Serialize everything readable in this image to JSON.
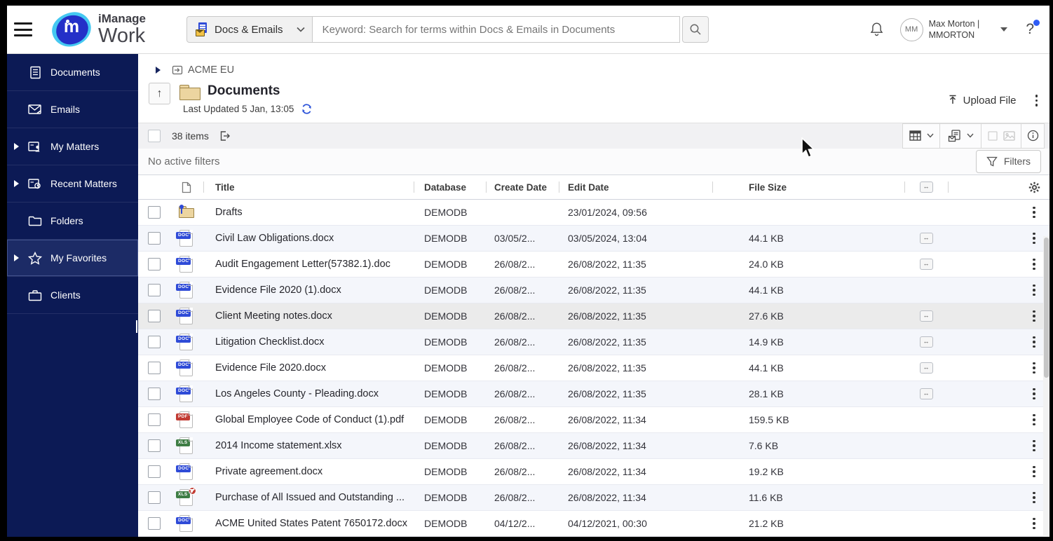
{
  "topbar": {
    "brand_line1": "iManage",
    "brand_line2": "Work",
    "scope_label": "Docs & Emails",
    "search_placeholder": "Keyword: Search for terms within Docs & Emails in Documents",
    "user": {
      "initials": "MM",
      "name": "Max Morton |",
      "username": "MMORTON"
    }
  },
  "sidebar": {
    "items": [
      {
        "label": "Documents",
        "icon": "document-icon",
        "expandable": false,
        "selected": false
      },
      {
        "label": "Emails",
        "icon": "email-icon",
        "expandable": false,
        "selected": false
      },
      {
        "label": "My Matters",
        "icon": "my-matters-icon",
        "expandable": true,
        "selected": false
      },
      {
        "label": "Recent Matters",
        "icon": "recent-matters-icon",
        "expandable": true,
        "selected": false
      },
      {
        "label": "Folders",
        "icon": "folder-icon",
        "expandable": false,
        "selected": false
      },
      {
        "label": "My Favorites",
        "icon": "star-icon",
        "expandable": true,
        "selected": true
      },
      {
        "label": "Clients",
        "icon": "briefcase-icon",
        "expandable": false,
        "selected": false
      }
    ]
  },
  "breadcrumb": {
    "workspace": "ACME EU"
  },
  "header": {
    "title": "Documents",
    "subtitle": "Last Updated 5 Jan, 13:05",
    "upload_label": "Upload File"
  },
  "toolbar": {
    "count": "38 items"
  },
  "filters": {
    "status": "No active filters",
    "button_label": "Filters"
  },
  "table": {
    "columns": {
      "title": "Title",
      "database": "Database",
      "create": "Create Date",
      "edit": "Edit Date",
      "size": "File Size"
    },
    "rows": [
      {
        "type": "folder",
        "badge": "",
        "title": "Drafts",
        "database": "DEMODB",
        "create": "",
        "edit": "23/01/2024, 09:56",
        "size": "",
        "linked": false,
        "hover": false
      },
      {
        "type": "doc",
        "badge": "DOC",
        "title": "Civil Law Obligations.docx",
        "database": "DEMODB",
        "create": "03/05/2...",
        "edit": "03/05/2024, 13:04",
        "size": "44.1 KB",
        "linked": true,
        "hover": false
      },
      {
        "type": "doc",
        "badge": "DOC",
        "title": "Audit Engagement Letter(57382.1).doc",
        "database": "DEMODB",
        "create": "26/08/2...",
        "edit": "26/08/2022, 11:35",
        "size": "24.0 KB",
        "linked": true,
        "hover": false
      },
      {
        "type": "doc",
        "badge": "DOC",
        "title": "Evidence File 2020 (1).docx",
        "database": "DEMODB",
        "create": "26/08/2...",
        "edit": "26/08/2022, 11:35",
        "size": "44.1 KB",
        "linked": false,
        "hover": false
      },
      {
        "type": "doc",
        "badge": "DOC",
        "title": "Client Meeting notes.docx",
        "database": "DEMODB",
        "create": "26/08/2...",
        "edit": "26/08/2022, 11:35",
        "size": "27.6 KB",
        "linked": true,
        "hover": true
      },
      {
        "type": "doc",
        "badge": "DOC",
        "title": "Litigation Checklist.docx",
        "database": "DEMODB",
        "create": "26/08/2...",
        "edit": "26/08/2022, 11:35",
        "size": "14.9 KB",
        "linked": true,
        "hover": false
      },
      {
        "type": "doc",
        "badge": "DOC",
        "title": "Evidence File 2020.docx",
        "database": "DEMODB",
        "create": "26/08/2...",
        "edit": "26/08/2022, 11:35",
        "size": "44.1 KB",
        "linked": true,
        "hover": false
      },
      {
        "type": "doc",
        "badge": "DOC",
        "title": "Los Angeles County - Pleading.docx",
        "database": "DEMODB",
        "create": "26/08/2...",
        "edit": "26/08/2022, 11:35",
        "size": "28.1 KB",
        "linked": true,
        "hover": false
      },
      {
        "type": "pdf",
        "badge": "PDF",
        "title": "Global Employee Code of Conduct (1).pdf",
        "database": "DEMODB",
        "create": "26/08/2...",
        "edit": "26/08/2022, 11:34",
        "size": "159.5 KB",
        "linked": false,
        "hover": false
      },
      {
        "type": "xls",
        "badge": "XLS",
        "title": "2014 Income statement.xlsx",
        "database": "DEMODB",
        "create": "26/08/2...",
        "edit": "26/08/2022, 11:34",
        "size": "7.6 KB",
        "linked": false,
        "hover": false
      },
      {
        "type": "doc",
        "badge": "DOC",
        "title": "Private agreement.docx",
        "database": "DEMODB",
        "create": "26/08/2...",
        "edit": "26/08/2022, 11:34",
        "size": "19.2 KB",
        "linked": false,
        "hover": false
      },
      {
        "type": "xls-locked",
        "badge": "XLS",
        "title": "Purchase of All Issued and Outstanding ...",
        "database": "DEMODB",
        "create": "26/08/2...",
        "edit": "26/08/2022, 11:34",
        "size": "11.6 KB",
        "linked": false,
        "hover": false
      },
      {
        "type": "doc",
        "badge": "DOC",
        "title": "ACME United States Patent 7650172.docx",
        "database": "DEMODB",
        "create": "04/12/2...",
        "edit": "04/12/2021, 00:30",
        "size": "21.2 KB",
        "linked": false,
        "hover": false
      }
    ]
  },
  "colors": {
    "sidebar_navy": "#0c1a55",
    "accent_blue": "#2b52d9",
    "doc_badge": "#2f4bd7",
    "pdf_badge": "#c23b33",
    "xls_badge": "#3e7d44",
    "folder_tan": "#ecd5a0"
  }
}
